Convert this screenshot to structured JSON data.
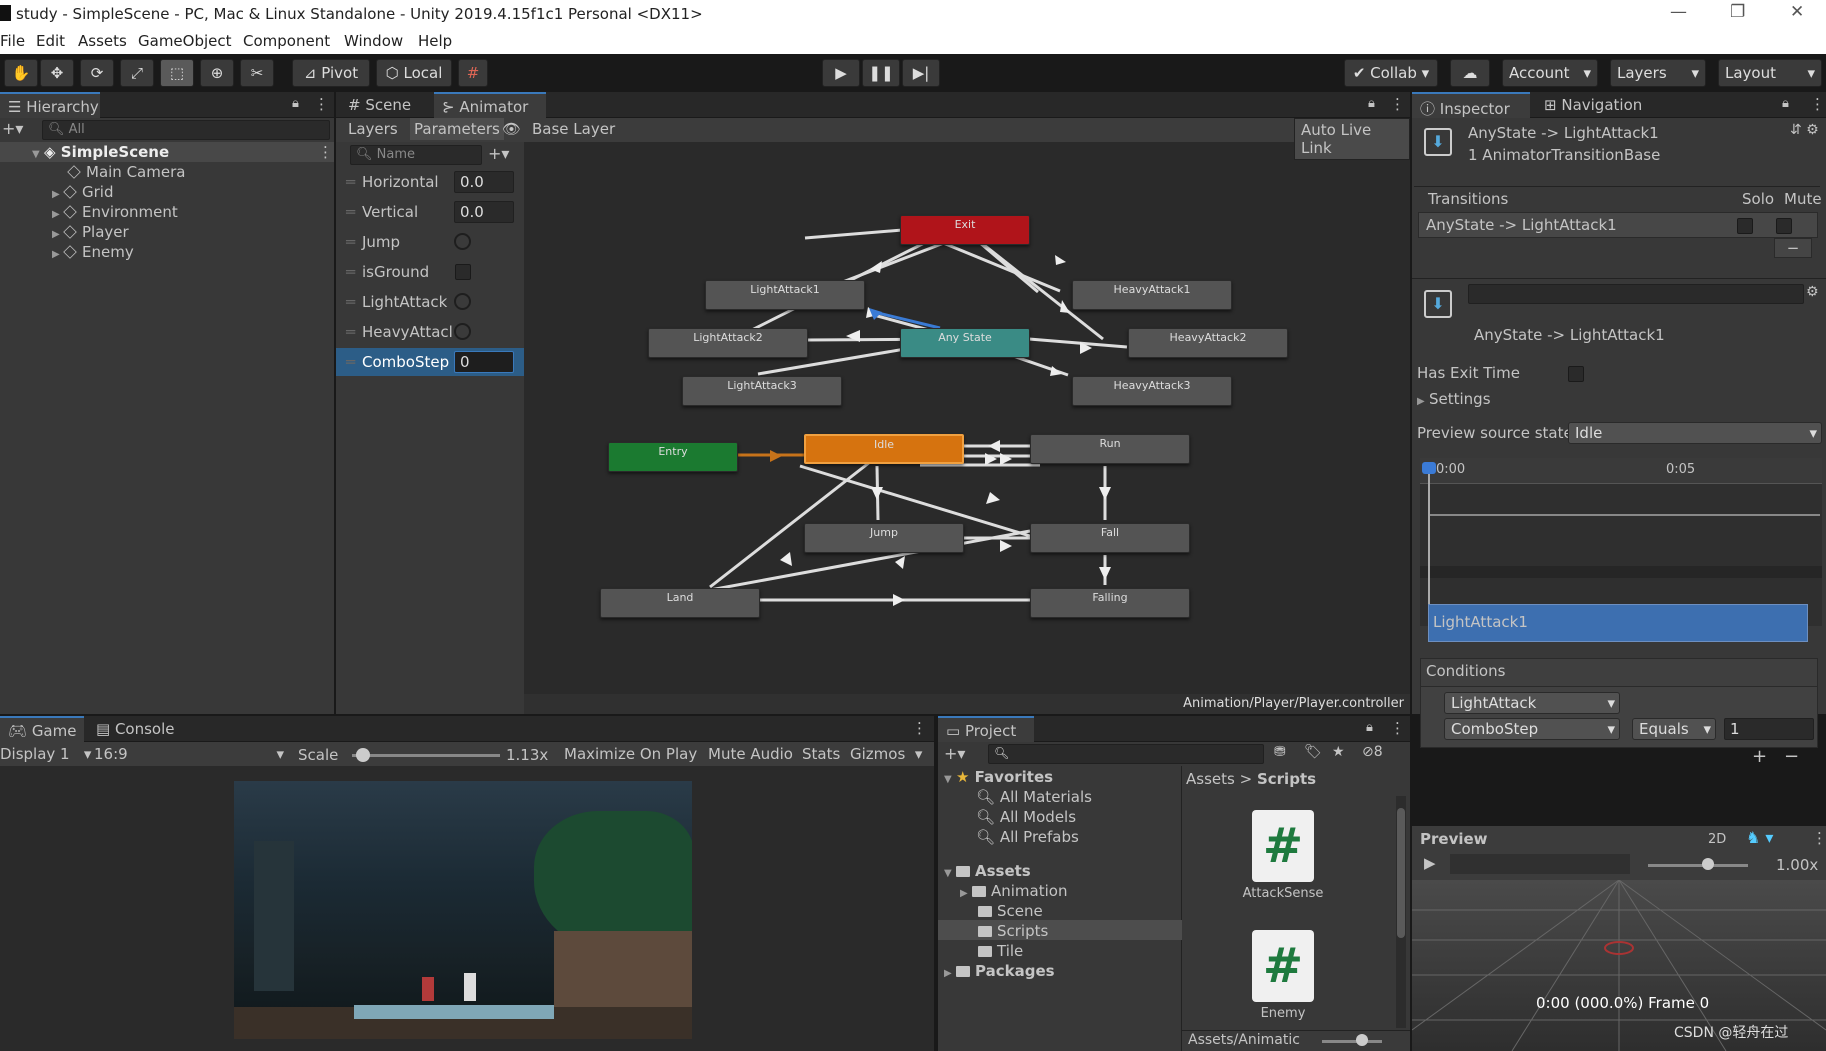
{
  "window": {
    "title": "study - SimpleScene - PC, Mac & Linux Standalone - Unity 2019.4.15f1c1 Personal <DX11>",
    "controls": [
      "—",
      "❐",
      "✕"
    ]
  },
  "menu": [
    "File",
    "Edit",
    "Assets",
    "GameObject",
    "Component",
    "Window",
    "Help"
  ],
  "toolbar": {
    "pivot": "Pivot",
    "local": "Local",
    "collab": "Collab",
    "account": "Account",
    "layers": "Layers",
    "layout": "Layout"
  },
  "hierarchy": {
    "tab": "Hierarchy",
    "search_placeholder": "All",
    "scene": "SimpleScene",
    "items": [
      "Main Camera",
      "Grid",
      "Environment",
      "Player",
      "Enemy"
    ]
  },
  "center_tabs": {
    "scene": "Scene",
    "animator": "Animator"
  },
  "animator": {
    "layers_tab": "Layers",
    "parameters_tab": "Parameters",
    "base_layer": "Base Layer",
    "auto_live_link": "Auto Live Link",
    "name_placeholder": "Name",
    "path": "Animation/Player/Player.controller",
    "params": [
      {
        "name": "Horizontal",
        "type": "float",
        "value": "0.0"
      },
      {
        "name": "Vertical",
        "type": "float",
        "value": "0.0"
      },
      {
        "name": "Jump",
        "type": "trigger"
      },
      {
        "name": "isGround",
        "type": "bool"
      },
      {
        "name": "LightAttack",
        "type": "trigger"
      },
      {
        "name": "HeavyAttacl",
        "type": "trigger"
      },
      {
        "name": "ComboStep",
        "type": "int",
        "value": "0"
      }
    ],
    "nodes": {
      "exit": "Exit",
      "la1": "LightAttack1",
      "la2": "LightAttack2",
      "la3": "LightAttack3",
      "any": "Any State",
      "ha1": "HeavyAttack1",
      "ha2": "HeavyAttack2",
      "ha3": "HeavyAttack3",
      "entry": "Entry",
      "idle": "Idle",
      "run": "Run",
      "jump": "Jump",
      "fall": "Fall",
      "land": "Land",
      "falling": "Falling"
    },
    "colors": {
      "exit": "#b0141a",
      "any": "#3a8b85",
      "entry": "#1b7a30",
      "idle": "#d6730f",
      "state": "#545454"
    }
  },
  "inspector": {
    "tab": "Inspector",
    "nav_tab": "Navigation",
    "header_title": "AnyState -> LightAttack1",
    "header_sub": "1 AnimatorTransitionBase",
    "transitions_label": "Transitions",
    "solo": "Solo",
    "mute": "Mute",
    "transition_row": "AnyState -> LightAttack1",
    "transition_name": "AnyState -> LightAttack1",
    "has_exit_time": "Has Exit Time",
    "settings": "Settings",
    "preview_source": "Preview source state",
    "preview_source_value": "Idle",
    "timeline_t0": "0:00",
    "timeline_t1": "0:05",
    "clip_name": "LightAttack1",
    "conditions_label": "Conditions",
    "conditions": [
      {
        "param": "LightAttack"
      },
      {
        "param": "ComboStep",
        "op": "Equals",
        "value": "1"
      }
    ],
    "preview_label": "Preview",
    "preview_2d": "2D",
    "preview_speed": "1.00x",
    "preview_time": "0:00 (000.0%) Frame 0",
    "watermark": "CSDN @轻舟在过"
  },
  "game": {
    "tab": "Game",
    "console_tab": "Console",
    "display": "Display 1",
    "aspect": "16:9",
    "scale_label": "Scale",
    "scale_value": "1.13x",
    "maximize": "Maximize On Play",
    "mute": "Mute Audio",
    "stats": "Stats",
    "gizmos": "Gizmos"
  },
  "project": {
    "tab": "Project",
    "hidden_count": "8",
    "favorites": "Favorites",
    "fav_items": [
      "All Materials",
      "All Models",
      "All Prefabs"
    ],
    "assets": "Assets",
    "asset_folders": [
      "Animation",
      "Scene",
      "Scripts",
      "Tile"
    ],
    "packages": "Packages",
    "breadcrumb_root": "Assets",
    "breadcrumb_sep": ">",
    "breadcrumb_current": "Scripts",
    "files": [
      "AttackSense",
      "Enemy"
    ],
    "bottom_path": "Assets/Animatic"
  }
}
